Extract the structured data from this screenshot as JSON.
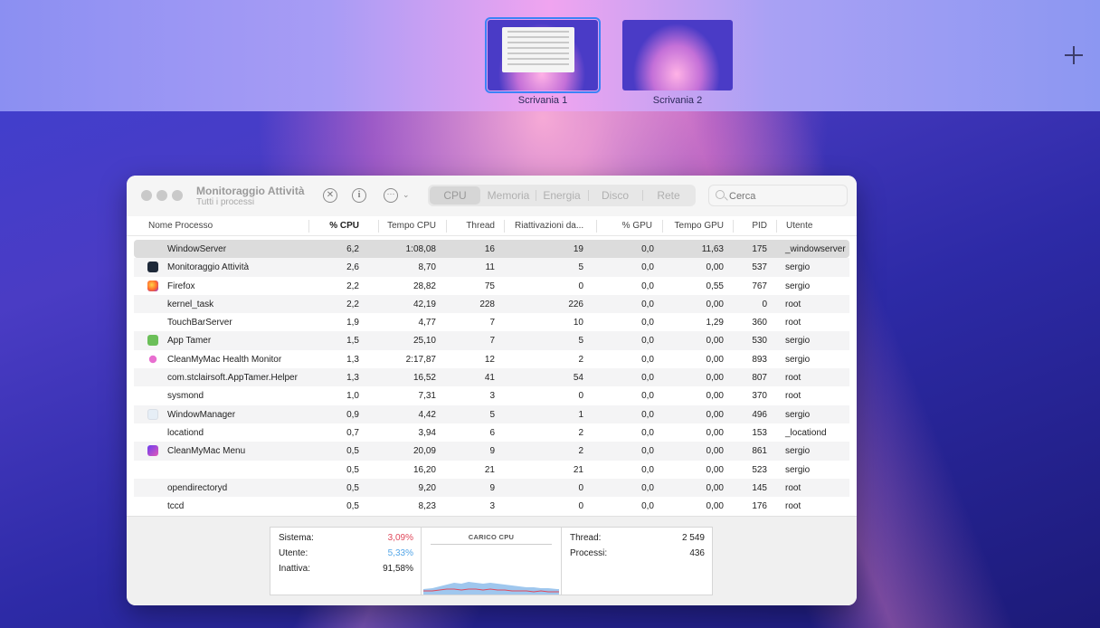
{
  "spaces": {
    "desktops": [
      {
        "label": "Scrivania 1",
        "active": true
      },
      {
        "label": "Scrivania 2",
        "active": false
      }
    ],
    "add_icon": "plus-icon"
  },
  "window": {
    "title": "Monitoraggio Attività",
    "subtitle": "Tutti i processi",
    "toolbar_icons": [
      "stop-process-icon",
      "info-icon",
      "more-options-icon",
      "chevron-down-icon"
    ],
    "tabs": [
      {
        "label": "CPU",
        "selected": true
      },
      {
        "label": "Memoria",
        "selected": false
      },
      {
        "label": "Energia",
        "selected": false
      },
      {
        "label": "Disco",
        "selected": false
      },
      {
        "label": "Rete",
        "selected": false
      }
    ],
    "search": {
      "placeholder": "Cerca",
      "value": ""
    }
  },
  "table": {
    "columns": [
      "Nome Processo",
      "% CPU",
      "Tempo CPU",
      "Thread",
      "Riattivazioni da...",
      "% GPU",
      "Tempo GPU",
      "PID",
      "Utente"
    ],
    "sorted_column": "% CPU",
    "rows": [
      {
        "name": "WindowServer",
        "icon": "",
        "cpu": "6,2",
        "time": "1:08,08",
        "threads": "16",
        "wakeups": "19",
        "gpu": "0,0",
        "gpu_time": "11,63",
        "pid": "175",
        "user": "_windowserver",
        "selected": true
      },
      {
        "name": "Monitoraggio Attività",
        "icon": "activity-monitor-icon",
        "cpu": "2,6",
        "time": "8,70",
        "threads": "11",
        "wakeups": "5",
        "gpu": "0,0",
        "gpu_time": "0,00",
        "pid": "537",
        "user": "sergio"
      },
      {
        "name": "Firefox",
        "icon": "firefox-icon",
        "cpu": "2,2",
        "time": "28,82",
        "threads": "75",
        "wakeups": "0",
        "gpu": "0,0",
        "gpu_time": "0,55",
        "pid": "767",
        "user": "sergio"
      },
      {
        "name": "kernel_task",
        "icon": "",
        "cpu": "2,2",
        "time": "42,19",
        "threads": "228",
        "wakeups": "226",
        "gpu": "0,0",
        "gpu_time": "0,00",
        "pid": "0",
        "user": "root"
      },
      {
        "name": "TouchBarServer",
        "icon": "",
        "cpu": "1,9",
        "time": "4,77",
        "threads": "7",
        "wakeups": "10",
        "gpu": "0,0",
        "gpu_time": "1,29",
        "pid": "360",
        "user": "root"
      },
      {
        "name": "App Tamer",
        "icon": "app-tamer-icon",
        "cpu": "1,5",
        "time": "25,10",
        "threads": "7",
        "wakeups": "5",
        "gpu": "0,0",
        "gpu_time": "0,00",
        "pid": "530",
        "user": "sergio"
      },
      {
        "name": "CleanMyMac Health Monitor",
        "icon": "cleanmymac-health-icon",
        "cpu": "1,3",
        "time": "2:17,87",
        "threads": "12",
        "wakeups": "2",
        "gpu": "0,0",
        "gpu_time": "0,00",
        "pid": "893",
        "user": "sergio"
      },
      {
        "name": "com.stclairsoft.AppTamer.Helper",
        "icon": "",
        "cpu": "1,3",
        "time": "16,52",
        "threads": "41",
        "wakeups": "54",
        "gpu": "0,0",
        "gpu_time": "0,00",
        "pid": "807",
        "user": "root"
      },
      {
        "name": "sysmond",
        "icon": "",
        "cpu": "1,0",
        "time": "7,31",
        "threads": "3",
        "wakeups": "0",
        "gpu": "0,0",
        "gpu_time": "0,00",
        "pid": "370",
        "user": "root"
      },
      {
        "name": "WindowManager",
        "icon": "window-manager-icon",
        "cpu": "0,9",
        "time": "4,42",
        "threads": "5",
        "wakeups": "1",
        "gpu": "0,0",
        "gpu_time": "0,00",
        "pid": "496",
        "user": "sergio"
      },
      {
        "name": "locationd",
        "icon": "",
        "cpu": "0,7",
        "time": "3,94",
        "threads": "6",
        "wakeups": "2",
        "gpu": "0,0",
        "gpu_time": "0,00",
        "pid": "153",
        "user": "_locationd"
      },
      {
        "name": "CleanMyMac Menu",
        "icon": "cleanmymac-menu-icon",
        "cpu": "0,5",
        "time": "20,09",
        "threads": "9",
        "wakeups": "2",
        "gpu": "0,0",
        "gpu_time": "0,00",
        "pid": "861",
        "user": "sergio"
      },
      {
        "name": "",
        "icon": "",
        "cpu": "0,5",
        "time": "16,20",
        "threads": "21",
        "wakeups": "21",
        "gpu": "0,0",
        "gpu_time": "0,00",
        "pid": "523",
        "user": "sergio"
      },
      {
        "name": "opendirectoryd",
        "icon": "",
        "cpu": "0,5",
        "time": "9,20",
        "threads": "9",
        "wakeups": "0",
        "gpu": "0,0",
        "gpu_time": "0,00",
        "pid": "145",
        "user": "root"
      },
      {
        "name": "tccd",
        "icon": "",
        "cpu": "0,5",
        "time": "8,23",
        "threads": "3",
        "wakeups": "0",
        "gpu": "0,0",
        "gpu_time": "0,00",
        "pid": "176",
        "user": "root"
      }
    ]
  },
  "stats": {
    "sistema": {
      "label": "Sistema:",
      "value": "3,09%",
      "color": "#e0475a"
    },
    "utente": {
      "label": "Utente:",
      "value": "5,33%",
      "color": "#55a7e8"
    },
    "inattiva": {
      "label": "Inattiva:",
      "value": "91,58%"
    },
    "cpu_load_title": "CARICO CPU",
    "thread": {
      "label": "Thread:",
      "value": "2 549"
    },
    "processi": {
      "label": "Processi:",
      "value": "436"
    }
  },
  "colors": {
    "accent": "#3b82f6",
    "sistema_line": "#e0475a",
    "utente_fill": "#9fc7ee"
  }
}
